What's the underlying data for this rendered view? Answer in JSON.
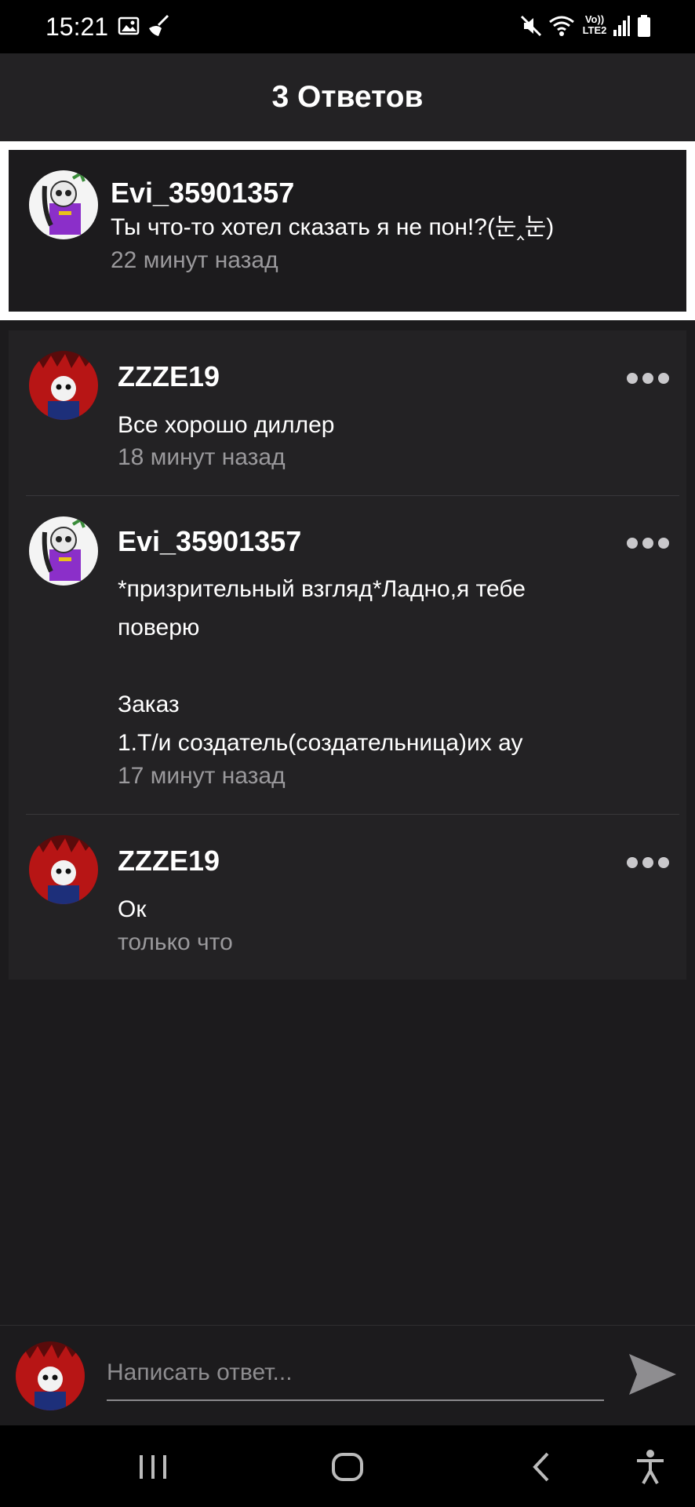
{
  "status_bar": {
    "time": "15:21",
    "network_label_top": "Vo))",
    "network_label_bottom": "LTE2"
  },
  "header": {
    "title": "3 Ответов"
  },
  "original_comment": {
    "username": "Evi_35901357",
    "text": "Ты что-то хотел сказать я не пон!?(눈‸눈)",
    "time": "22 минут назад",
    "avatar": "purple-character-avatar"
  },
  "replies": [
    {
      "username": "ZZZE19",
      "text": "Все хорошо диллер",
      "time": "18 минут назад",
      "avatar": "red-skeleton-avatar"
    },
    {
      "username": "Evi_35901357",
      "text": "*призрительный взгляд*Ладно,я тебе\nповерю\n\nЗаказ\n1.Т/и создатель(создательница)их ау",
      "time": "17 минут назад",
      "avatar": "purple-character-avatar"
    },
    {
      "username": "ZZZE19",
      "text": "Ок",
      "time": "только что",
      "avatar": "red-skeleton-avatar"
    }
  ],
  "composer": {
    "placeholder": "Написать ответ..."
  },
  "colors": {
    "background": "#1c1b1d",
    "card": "#232224",
    "secondary_text": "#9a999c",
    "highlight_border": "#ffffff"
  }
}
